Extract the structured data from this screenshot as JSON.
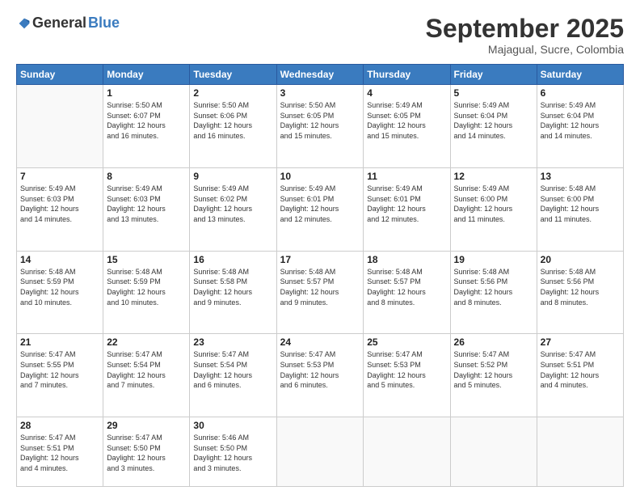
{
  "logo": {
    "general": "General",
    "blue": "Blue"
  },
  "title": "September 2025",
  "subtitle": "Majagual, Sucre, Colombia",
  "days_header": [
    "Sunday",
    "Monday",
    "Tuesday",
    "Wednesday",
    "Thursday",
    "Friday",
    "Saturday"
  ],
  "weeks": [
    [
      {
        "day": "",
        "info": ""
      },
      {
        "day": "1",
        "info": "Sunrise: 5:50 AM\nSunset: 6:07 PM\nDaylight: 12 hours\nand 16 minutes."
      },
      {
        "day": "2",
        "info": "Sunrise: 5:50 AM\nSunset: 6:06 PM\nDaylight: 12 hours\nand 16 minutes."
      },
      {
        "day": "3",
        "info": "Sunrise: 5:50 AM\nSunset: 6:05 PM\nDaylight: 12 hours\nand 15 minutes."
      },
      {
        "day": "4",
        "info": "Sunrise: 5:49 AM\nSunset: 6:05 PM\nDaylight: 12 hours\nand 15 minutes."
      },
      {
        "day": "5",
        "info": "Sunrise: 5:49 AM\nSunset: 6:04 PM\nDaylight: 12 hours\nand 14 minutes."
      },
      {
        "day": "6",
        "info": "Sunrise: 5:49 AM\nSunset: 6:04 PM\nDaylight: 12 hours\nand 14 minutes."
      }
    ],
    [
      {
        "day": "7",
        "info": "Sunrise: 5:49 AM\nSunset: 6:03 PM\nDaylight: 12 hours\nand 14 minutes."
      },
      {
        "day": "8",
        "info": "Sunrise: 5:49 AM\nSunset: 6:03 PM\nDaylight: 12 hours\nand 13 minutes."
      },
      {
        "day": "9",
        "info": "Sunrise: 5:49 AM\nSunset: 6:02 PM\nDaylight: 12 hours\nand 13 minutes."
      },
      {
        "day": "10",
        "info": "Sunrise: 5:49 AM\nSunset: 6:01 PM\nDaylight: 12 hours\nand 12 minutes."
      },
      {
        "day": "11",
        "info": "Sunrise: 5:49 AM\nSunset: 6:01 PM\nDaylight: 12 hours\nand 12 minutes."
      },
      {
        "day": "12",
        "info": "Sunrise: 5:49 AM\nSunset: 6:00 PM\nDaylight: 12 hours\nand 11 minutes."
      },
      {
        "day": "13",
        "info": "Sunrise: 5:48 AM\nSunset: 6:00 PM\nDaylight: 12 hours\nand 11 minutes."
      }
    ],
    [
      {
        "day": "14",
        "info": "Sunrise: 5:48 AM\nSunset: 5:59 PM\nDaylight: 12 hours\nand 10 minutes."
      },
      {
        "day": "15",
        "info": "Sunrise: 5:48 AM\nSunset: 5:59 PM\nDaylight: 12 hours\nand 10 minutes."
      },
      {
        "day": "16",
        "info": "Sunrise: 5:48 AM\nSunset: 5:58 PM\nDaylight: 12 hours\nand 9 minutes."
      },
      {
        "day": "17",
        "info": "Sunrise: 5:48 AM\nSunset: 5:57 PM\nDaylight: 12 hours\nand 9 minutes."
      },
      {
        "day": "18",
        "info": "Sunrise: 5:48 AM\nSunset: 5:57 PM\nDaylight: 12 hours\nand 8 minutes."
      },
      {
        "day": "19",
        "info": "Sunrise: 5:48 AM\nSunset: 5:56 PM\nDaylight: 12 hours\nand 8 minutes."
      },
      {
        "day": "20",
        "info": "Sunrise: 5:48 AM\nSunset: 5:56 PM\nDaylight: 12 hours\nand 8 minutes."
      }
    ],
    [
      {
        "day": "21",
        "info": "Sunrise: 5:47 AM\nSunset: 5:55 PM\nDaylight: 12 hours\nand 7 minutes."
      },
      {
        "day": "22",
        "info": "Sunrise: 5:47 AM\nSunset: 5:54 PM\nDaylight: 12 hours\nand 7 minutes."
      },
      {
        "day": "23",
        "info": "Sunrise: 5:47 AM\nSunset: 5:54 PM\nDaylight: 12 hours\nand 6 minutes."
      },
      {
        "day": "24",
        "info": "Sunrise: 5:47 AM\nSunset: 5:53 PM\nDaylight: 12 hours\nand 6 minutes."
      },
      {
        "day": "25",
        "info": "Sunrise: 5:47 AM\nSunset: 5:53 PM\nDaylight: 12 hours\nand 5 minutes."
      },
      {
        "day": "26",
        "info": "Sunrise: 5:47 AM\nSunset: 5:52 PM\nDaylight: 12 hours\nand 5 minutes."
      },
      {
        "day": "27",
        "info": "Sunrise: 5:47 AM\nSunset: 5:51 PM\nDaylight: 12 hours\nand 4 minutes."
      }
    ],
    [
      {
        "day": "28",
        "info": "Sunrise: 5:47 AM\nSunset: 5:51 PM\nDaylight: 12 hours\nand 4 minutes."
      },
      {
        "day": "29",
        "info": "Sunrise: 5:47 AM\nSunset: 5:50 PM\nDaylight: 12 hours\nand 3 minutes."
      },
      {
        "day": "30",
        "info": "Sunrise: 5:46 AM\nSunset: 5:50 PM\nDaylight: 12 hours\nand 3 minutes."
      },
      {
        "day": "",
        "info": ""
      },
      {
        "day": "",
        "info": ""
      },
      {
        "day": "",
        "info": ""
      },
      {
        "day": "",
        "info": ""
      }
    ]
  ]
}
